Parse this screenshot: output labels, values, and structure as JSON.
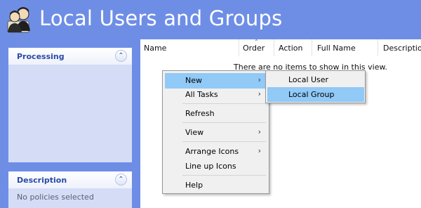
{
  "window": {
    "title": "Local Users and Groups",
    "icon": "users-icon"
  },
  "sidebar": {
    "panels": [
      {
        "title": "Processing",
        "toggle_icon": "collapse-up-icon",
        "body_text": ""
      },
      {
        "title": "Description",
        "toggle_icon": "collapse-up-icon",
        "body_text": "No policies selected"
      }
    ]
  },
  "list": {
    "columns": [
      "Name",
      "Order",
      "Action",
      "Full Name",
      "Description"
    ],
    "sorted_column": "Order",
    "empty_message": "There are no items to show in this view."
  },
  "context_menu": {
    "items": [
      {
        "label": "New",
        "has_submenu": true,
        "highlighted": true
      },
      {
        "label": "All Tasks",
        "has_submenu": true,
        "highlighted": false
      },
      {
        "label": "Refresh",
        "has_submenu": false,
        "highlighted": false
      },
      {
        "label": "View",
        "has_submenu": true,
        "highlighted": false
      },
      {
        "label": "Arrange Icons",
        "has_submenu": true,
        "highlighted": false
      },
      {
        "label": "Line up Icons",
        "has_submenu": false,
        "highlighted": false
      },
      {
        "label": "Help",
        "has_submenu": false,
        "highlighted": false
      }
    ],
    "submenu_arrow": "›"
  },
  "submenu": {
    "items": [
      {
        "label": "Local User",
        "highlighted": false
      },
      {
        "label": "Local Group",
        "highlighted": true
      }
    ]
  },
  "colors": {
    "header_blue": "#6e8ee6",
    "panel_bg": "#d5dcf6",
    "panel_title": "#2a4aa6",
    "menu_highlight": "#91c9f7",
    "menu_bg": "#f0f0f0"
  }
}
